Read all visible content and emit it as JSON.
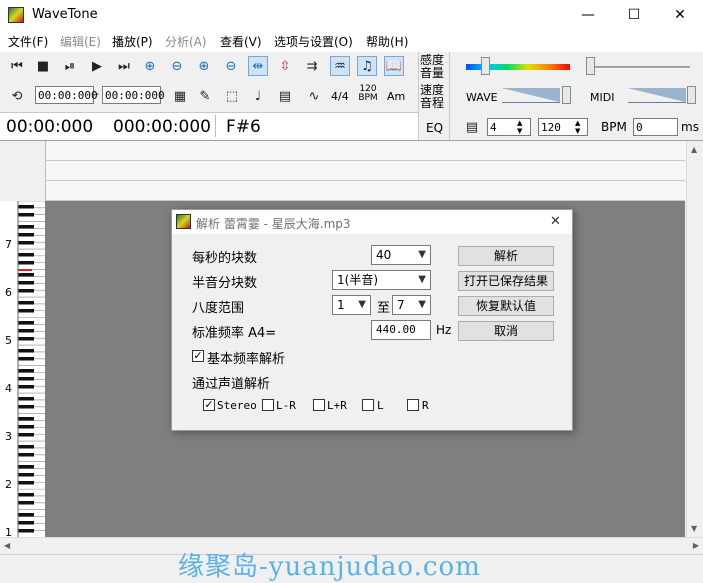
{
  "window": {
    "title": "WaveTone",
    "minimize": "—",
    "maximize": "☐",
    "close": "✕"
  },
  "menu": [
    {
      "label": "文件(F)",
      "disabled": false
    },
    {
      "label": "编辑(E)",
      "disabled": true
    },
    {
      "label": "播放(P)",
      "disabled": false
    },
    {
      "label": "分析(A)",
      "disabled": true
    },
    {
      "label": "查看(V)",
      "disabled": false
    },
    {
      "label": "选项与设置(O)",
      "disabled": false
    },
    {
      "label": "帮助(H)",
      "disabled": false
    }
  ],
  "toolbar": {
    "time_start": "00:00:000",
    "time_end": "00:00:000",
    "time_sep": "-",
    "beat_label": "4/4",
    "bpm_icon_top": "120",
    "bpm_icon_bottom": "BPM",
    "am_label": "Am"
  },
  "time_display": {
    "current": "00:00:000",
    "total": "000:00:000",
    "note": "F#6"
  },
  "right_panel": {
    "sensitivity_line1": "感度",
    "sensitivity_line2": "音量",
    "speed_line1": "速度",
    "speed_line2": "音程",
    "eq_label": "EQ",
    "wave_label": "WAVE",
    "midi_label": "MIDI",
    "beats_value": "4",
    "bpm_value": "120",
    "bpm_label": "BPM",
    "ms_value": "0",
    "ms_label": "ms"
  },
  "piano": {
    "octaves": [
      "7",
      "6",
      "5",
      "4",
      "3",
      "2",
      "1"
    ]
  },
  "dialog": {
    "title": "解析 蕾霄霎 - 星辰大海.mp3",
    "close": "✕",
    "blocks_per_sec_label": "每秒的块数",
    "blocks_per_sec_value": "40",
    "semitone_label": "半音分块数",
    "semitone_value": "1(半音)",
    "octave_label": "八度范围",
    "octave_from": "1",
    "octave_to_label": "至",
    "octave_to": "7",
    "freq_label": "标准频率 A4=",
    "freq_value": "440.00",
    "freq_unit": "Hz",
    "fundamental_label": "基本频率解析",
    "fundamental_checked": true,
    "channel_label": "通过声道解析",
    "channels": [
      {
        "label": "Stereo",
        "checked": true
      },
      {
        "label": "L-R",
        "checked": false
      },
      {
        "label": "L+R",
        "checked": false
      },
      {
        "label": "L",
        "checked": false
      },
      {
        "label": "R",
        "checked": false
      }
    ],
    "buttons": {
      "analyze": "解析",
      "open_saved": "打开已保存结果",
      "restore": "恢复默认值",
      "cancel": "取消"
    }
  },
  "watermark": "缘聚岛-yuanjudao.com"
}
